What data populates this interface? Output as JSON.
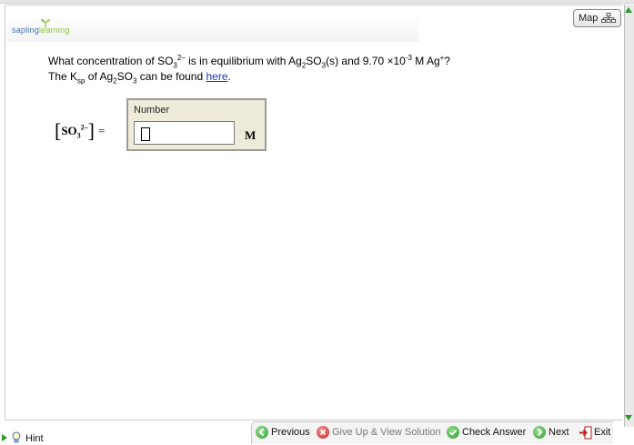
{
  "header": {
    "logo_part1": "sapling",
    "logo_part2": "learning",
    "map_label": "Map"
  },
  "question": {
    "line1_a": "What concentration of SO",
    "line1_a_sub": "3",
    "line1_a_sup": "2–",
    "line1_b": " is in equilibrium with Ag",
    "line1_b_sub": "2",
    "line1_c": "SO",
    "line1_c_sub": "3",
    "line1_d": "(s) and 9.70 ×10",
    "line1_d_sup": "-3",
    "line1_e": " M Ag",
    "line1_e_sup": "+",
    "line1_f": "?",
    "line2_a": "The K",
    "line2_a_sub": "sp",
    "line2_b": " of Ag",
    "line2_b_sub": "2",
    "line2_c": "SO",
    "line2_c_sub": "3",
    "line2_d": " can be found ",
    "line2_link": "here",
    "line2_e": "."
  },
  "answer": {
    "expression_species": "SO",
    "expression_sub": "3",
    "expression_sup": "2–",
    "expression_equals": "=",
    "box_title": "Number",
    "input_value": "",
    "unit": "M"
  },
  "footer": {
    "hint_label": "Hint",
    "previous_label": "Previous",
    "giveup_label": "Give Up & View Solution",
    "check_label": "Check Answer",
    "next_label": "Next",
    "exit_label": "Exit"
  },
  "colors": {
    "link": "#1a35b8",
    "brand_blue": "#3a6fb2",
    "brand_green": "#8cbf3f",
    "answer_bg": "#efebdb",
    "action_green": "#2a9a2a",
    "giveup_red": "#c42020"
  }
}
